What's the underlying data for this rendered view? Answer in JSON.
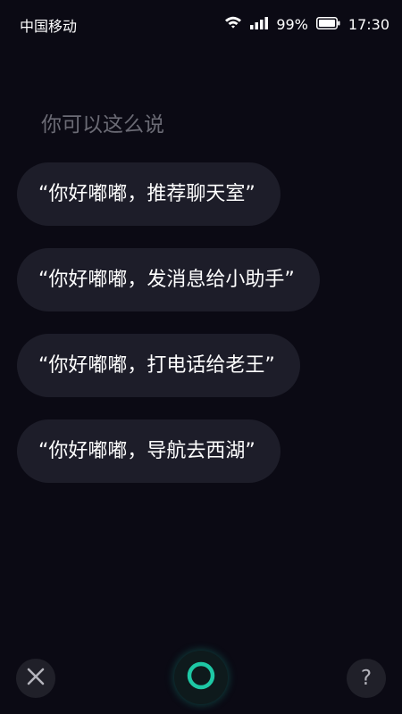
{
  "status_bar": {
    "carrier": "中国移动",
    "battery_percent": "99%",
    "time": "17:30",
    "icons": [
      "wifi-icon",
      "signal-icon",
      "battery-icon"
    ]
  },
  "hint": {
    "title": "你可以这么说"
  },
  "suggestions": [
    {
      "label": "“你好嘟嘟，推荐聊天室”"
    },
    {
      "label": "“你好嘟嘟，发消息给小助手”"
    },
    {
      "label": "“你好嘟嘟，打电话给老王”"
    },
    {
      "label": "“你好嘟嘟，导航去西湖”"
    }
  ],
  "controls": {
    "close_icon": "close-icon",
    "voice_icon": "voice-ring-icon",
    "help_text": "?"
  },
  "colors": {
    "background": "#0b0a14",
    "pill": "#1d1d29",
    "hint_text": "#6b6b75",
    "accent": "#1ec8a5"
  }
}
